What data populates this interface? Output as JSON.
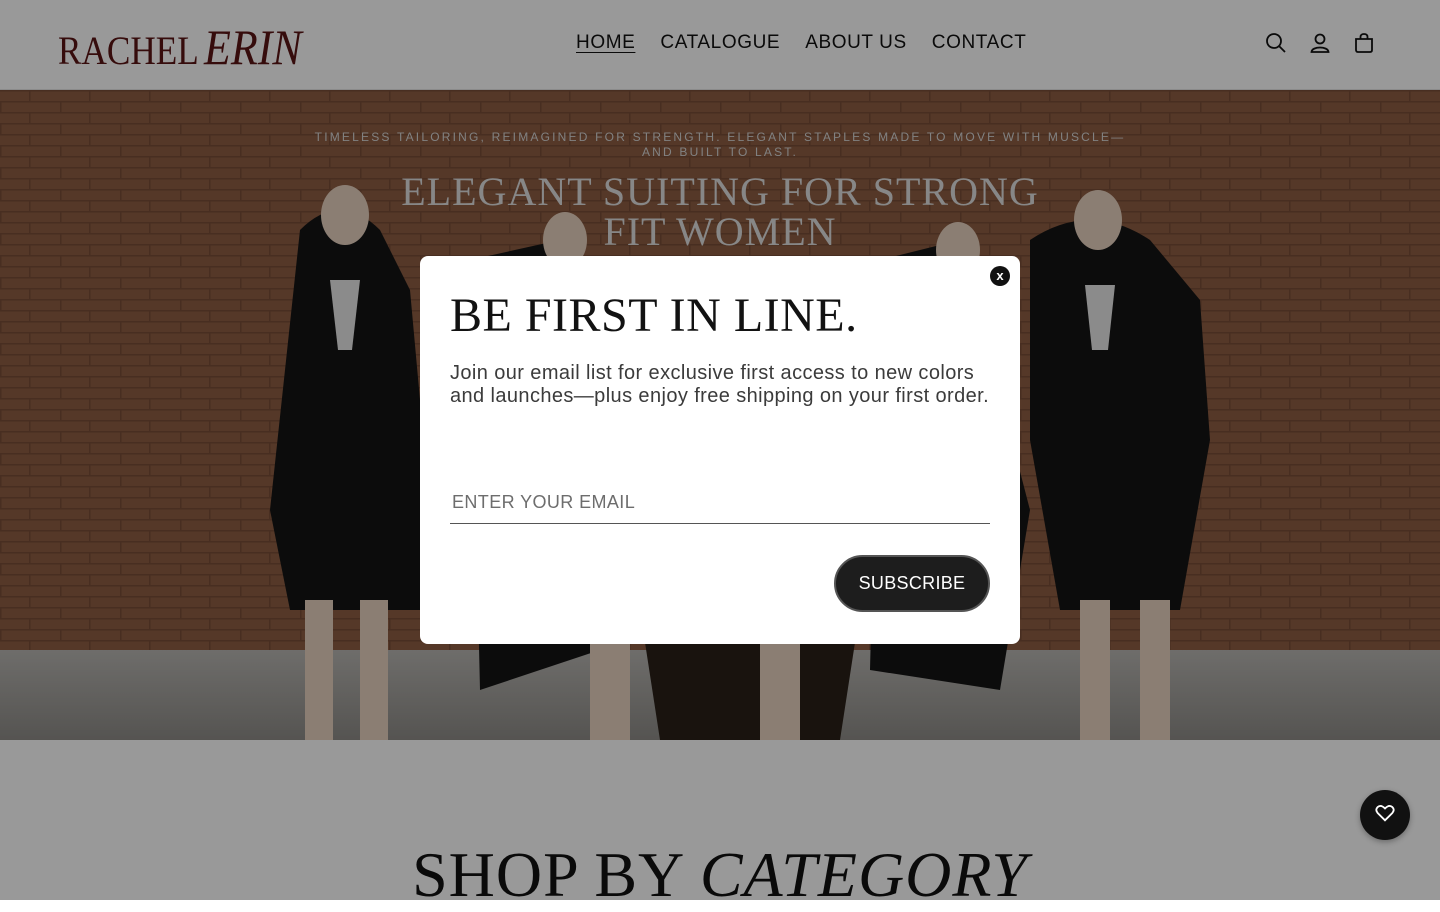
{
  "header": {
    "logo": {
      "part1": "RACHEL",
      "part2": "ERIN",
      "color": "#5a1414"
    },
    "nav": [
      {
        "label": "HOME",
        "active": true
      },
      {
        "label": "CATALOGUE",
        "active": false
      },
      {
        "label": "ABOUT US",
        "active": false
      },
      {
        "label": "CONTACT",
        "active": false
      }
    ],
    "icons": [
      "search-icon",
      "account-icon",
      "cart-icon"
    ]
  },
  "hero": {
    "tagline": "TIMELESS TAILORING, REIMAGINED FOR STRENGTH. ELEGANT STAPLES MADE TO MOVE WITH MUSCLE—AND BUILT TO LAST.",
    "title": "ELEGANT SUITING FOR STRONG FIT WOMEN"
  },
  "section": {
    "title_plain": "SHOP BY",
    "title_italic": "CATEGORY"
  },
  "popup": {
    "close_label": "x",
    "title": "BE FIRST IN LINE.",
    "body": "Join our email list for exclusive first access to new colors and launches—plus enjoy free shipping on your first order.",
    "email_placeholder": "ENTER YOUR EMAIL",
    "email_value": "",
    "subscribe_label": "SUBSCRIBE"
  },
  "floating": {
    "icon": "heart-icon"
  },
  "colors": {
    "overlay": "rgba(0,0,0,0.4)",
    "button": "#1d1d1d",
    "brand": "#5a1414"
  }
}
